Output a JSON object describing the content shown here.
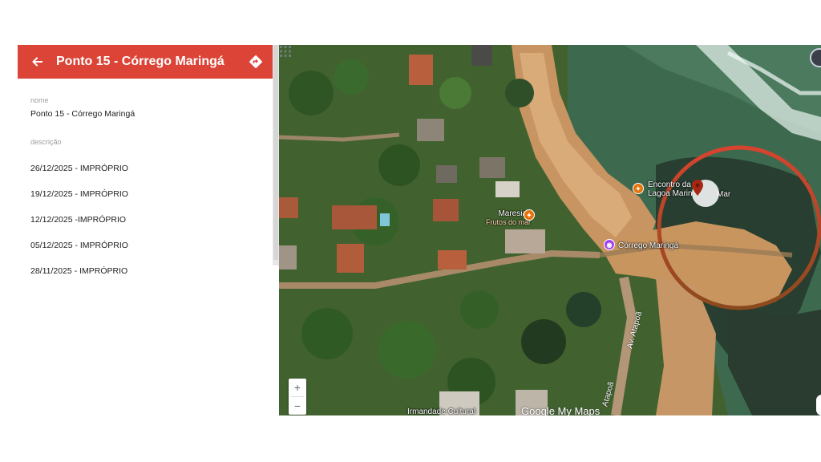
{
  "header": {
    "title": "Ponto 15 - Córrego Maringá",
    "back_icon": "arrow-left-icon",
    "directions_icon": "directions-icon",
    "color": "#db4437"
  },
  "details": {
    "name_label": "nome",
    "name_value": "Ponto 15 - Córrego Maringá",
    "description_label": "descrição",
    "description_lines": [
      "26/12/2025 - IMPRÓPRIO",
      "19/12/2025 - IMPRÓPRIO",
      "12/12/2025 -IMPRÓPRIO",
      "05/12/2025 - IMPRÓPRIO",
      "28/11/2025 - IMPRÓPRIO"
    ]
  },
  "map": {
    "places": {
      "restaurant1_line1": "Encontro das Águas",
      "restaurant1_line2": "Lagoa Maringá",
      "restaurant1_suffix": "Mar",
      "restaurant1_short1": "Encontro da",
      "restaurant1_short2": "Lagoa Marin",
      "maresias": "Maresias",
      "maresias_sub": "Frutos do mar",
      "corrego": "Córrego Maringá",
      "irmandade": "Irmandade Cultural"
    },
    "roads": {
      "av_atapoa": "Av. Atapoã",
      "atapoa": "Atapoã"
    },
    "brand": "Google My Maps",
    "zoom_in": "+",
    "zoom_out": "−",
    "highlight_color": "#cf4a2e",
    "marker_color": "#a52714"
  }
}
